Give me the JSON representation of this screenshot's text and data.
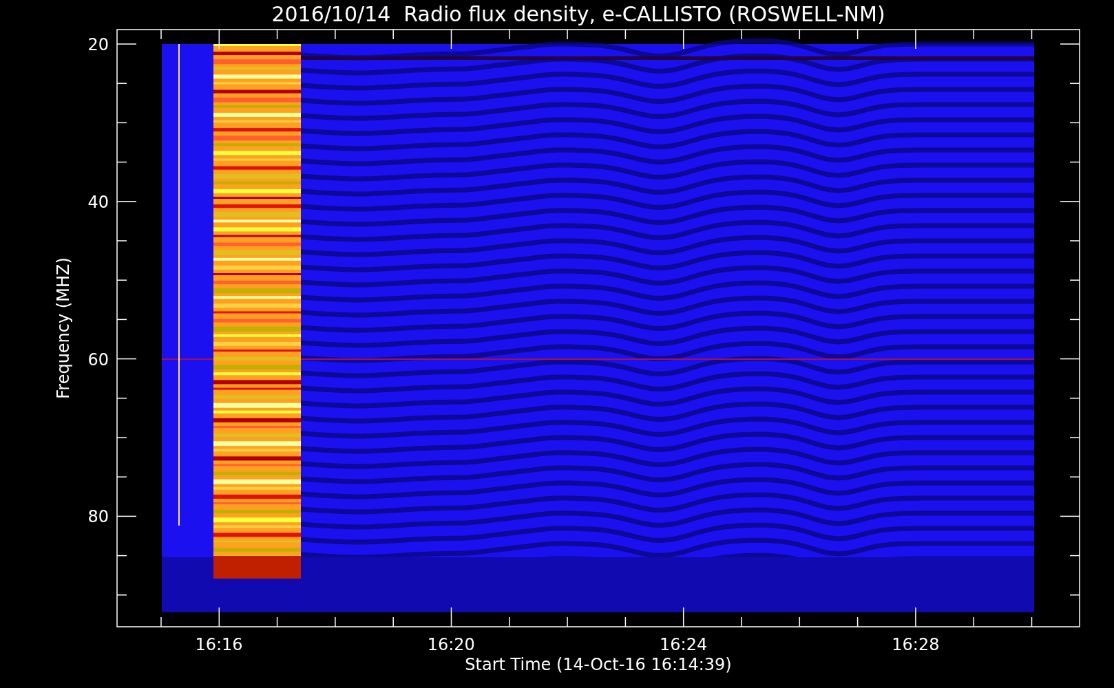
{
  "plot": {
    "title": "2016/10/14  Radio flux density, e-CALLISTO (ROSWELL-NM)",
    "ylabel": "Frequency (MHZ)",
    "xlabel": "Start Time (14-Oct-16 16:14:39)",
    "yticks": [
      "20",
      "40",
      "60",
      "80"
    ],
    "xticks": [
      "16:16",
      "16:20",
      "16:24",
      "16:28"
    ]
  }
}
